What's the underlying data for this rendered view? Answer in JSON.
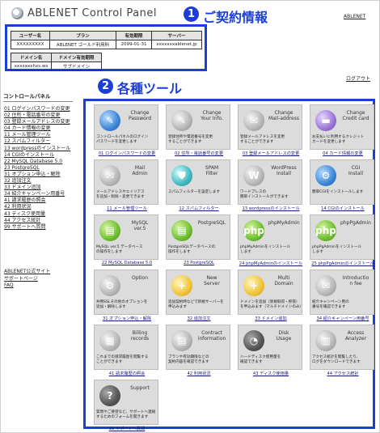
{
  "header": {
    "title": "ABLENET Control Panel",
    "top_link": "ABLENET",
    "logout": "ログアウト"
  },
  "annotations": {
    "contract_num": "1",
    "contract_label": "ご契約情報",
    "tools_num": "2",
    "tools_label": "各種ツール"
  },
  "contract": {
    "headers1": [
      "ユーザー名",
      "プラン",
      "有効期限",
      "サーバー"
    ],
    "values1": [
      "XXXXXXXXX",
      "ABLENET ゴールド利用料",
      "2099-01-31",
      "xxxxxxxablenet.jp"
    ],
    "headers2": [
      "ドメイン名",
      "ドメイン有効期限"
    ],
    "values2": [
      "xxxxxxxhxs.ws",
      "サブドメイン"
    ]
  },
  "sidebar": {
    "heading": "コントロールパネル",
    "items": [
      "01 ログインパスワードの変更",
      "02 住所・電話番号の変更",
      "03 登録メールアドレスの変更",
      "04 カード情報の変更",
      "11 メール管理ツール",
      "12 スパムフィルター",
      "13 wordpressのインストール",
      "14 CGIのインストール",
      "22 MySQL Database 5.0",
      "23 PostgreSQL",
      "31 オプション申込・解除",
      "32 追加注文",
      "33 ドメイン追加",
      "34 紹介キャンペーン用番号",
      "41 請求履歴の照会",
      "42 利用状況",
      "43 ディスク使用量",
      "44 アクセス統計",
      "99 サポートへ質問"
    ],
    "links": [
      "ABLENET公式サイト",
      "サポートページ",
      "FAQ"
    ]
  },
  "tools": [
    {
      "title": "Change\nPassword",
      "desc": "コントロールパネルのログイン\nパスワードを変更します",
      "caption": "01 ログインパスワードの変更",
      "icon": "key-icon",
      "color": "ic-blue",
      "glyph": "✎"
    },
    {
      "title": "Change\nYour Info.",
      "desc": "登録住所や電話番号を変更\nすることができます",
      "caption": "02 住所・電話番号の変更",
      "icon": "info-icon",
      "color": "ic-gray",
      "glyph": "✎"
    },
    {
      "title": "Change\nMail-address",
      "desc": "登録メールアドレスを変更\nすることができます",
      "caption": "03 登録メールアドレスの変更",
      "icon": "mail-edit-icon",
      "color": "ic-gray",
      "glyph": "✉"
    },
    {
      "title": "Change\nCredit card",
      "desc": "お支払いに利用するクレジット\nカードを変更します",
      "caption": "04 カード情報の変更",
      "icon": "credit-card-icon",
      "color": "ic-purple",
      "glyph": "▬"
    },
    {
      "title": "Mail\nAdmin",
      "desc": "メールアドレスやエイリアス\nを追加・削除・変更できます",
      "caption": "11 メール管理ツール",
      "icon": "mail-icon",
      "color": "ic-gray",
      "glyph": "✉"
    },
    {
      "title": "SPAM\nFilter",
      "desc": "スパムフィルターを設定します",
      "caption": "12 スパムフィルター",
      "icon": "filter-icon",
      "color": "ic-teal",
      "glyph": "⛊"
    },
    {
      "title": "WordPress\nInstall",
      "desc": "ワードプレスの\n簡単インストールができます",
      "caption": "13 wordpressのインストール",
      "icon": "wordpress-icon",
      "color": "ic-gray",
      "glyph": "W"
    },
    {
      "title": "CGI\nInstall",
      "desc": "簡単CGIをインストールします",
      "caption": "14 CGIのインストール",
      "icon": "cgi-icon",
      "color": "ic-blue",
      "glyph": "⚙"
    },
    {
      "title": "MySQL\nver.5",
      "desc": "MySQL ver.5 データベース\nの操作をします",
      "caption": "22 MySQL Database 5.0",
      "icon": "mysql-icon",
      "color": "ic-green",
      "glyph": "▤"
    },
    {
      "title": "PostgreSQL",
      "desc": "PostgreSQLデータベースの\n操作をします",
      "caption": "23 PostgreSQL",
      "icon": "postgresql-icon",
      "color": "ic-green",
      "glyph": "▤"
    },
    {
      "title": "phpMyAdmin",
      "desc": "phpMyAdminをインストール\nします",
      "caption": "24 phpMyAdminのインストール",
      "icon": "phpmyadmin-icon",
      "color": "ic-green",
      "glyph": "php"
    },
    {
      "title": "phpPgAdmin",
      "desc": "phpPgAdminをインストール\nします",
      "caption": "25 phpPgAdminのインストール",
      "icon": "phppgadmin-icon",
      "color": "ic-green",
      "glyph": "php"
    },
    {
      "title": "Option",
      "desc": "共用SSLその他のオプションを\n追加・解除します",
      "caption": "31 オプション申込・解除",
      "icon": "option-icon",
      "color": "ic-gray",
      "glyph": "⚙"
    },
    {
      "title": "New\nServer",
      "desc": "追加契約時などで新規サーバーを\n申込みます",
      "caption": "32 追加注文",
      "icon": "new-server-icon",
      "color": "ic-yellow",
      "glyph": "+"
    },
    {
      "title": "Multi\nDomain",
      "desc": "ドメインを追加（新規取得・移管）\nを申込みます（マルチドメインのみ）",
      "caption": "33 ドメイン追加",
      "icon": "multi-domain-icon",
      "color": "ic-yellow",
      "glyph": "+"
    },
    {
      "title": "Introductio\nn fee",
      "desc": "紹介キャンペーン用の\n番号を確認できます",
      "caption": "34 紹介キャンペーン用番号",
      "icon": "introduction-icon",
      "color": "ic-gray",
      "glyph": "✉"
    },
    {
      "title": "Billing\nrecords",
      "desc": "これまでの請求履歴を閲覧する\nことができます",
      "caption": "41 請求履歴の照会",
      "icon": "billing-icon",
      "color": "ic-gray",
      "glyph": "▦"
    },
    {
      "title": "Contract\ninformation",
      "desc": "プランや有効期限などの\n契約内容を確認できます",
      "caption": "42 利用状況",
      "icon": "contract-icon",
      "color": "ic-gray",
      "glyph": "▤"
    },
    {
      "title": "Disk\nUsage",
      "desc": "ハードディスク使用量を\n確認できます",
      "caption": "43 ディスク使用量",
      "icon": "disk-icon",
      "color": "ic-dark",
      "glyph": "◔"
    },
    {
      "title": "Access\nAnalyzer",
      "desc": "アクセス統計を閲覧したり、\nログをダウンロードできます",
      "caption": "44 アクセス統計",
      "icon": "analyzer-icon",
      "color": "ic-gray",
      "glyph": "▥"
    },
    {
      "title": "Support",
      "desc": "質問やご要望など、サポートへ連絡\nするためのフォームを開きます",
      "caption": "99 サポートへ質問",
      "icon": "support-icon",
      "color": "ic-dark",
      "glyph": "?"
    }
  ]
}
